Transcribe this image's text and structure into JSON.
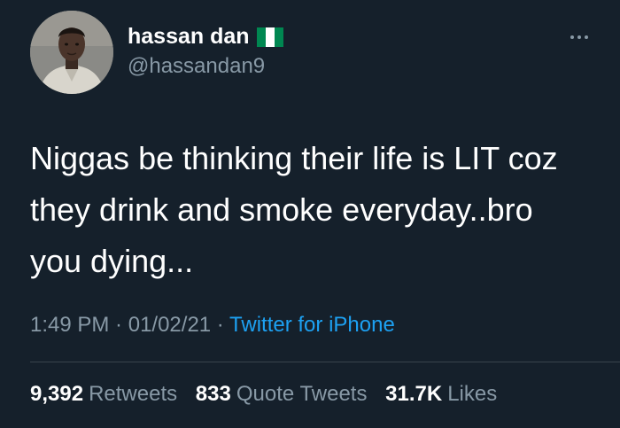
{
  "author": {
    "name": "hassan dan",
    "handle": "@hassandan9",
    "flag_icon": "nigeria-flag-icon",
    "flag_colors": [
      "#008751",
      "#ffffff",
      "#008751"
    ]
  },
  "tweet": {
    "text": "Niggas be thinking their life is LIT coz\nthey drink and smoke everyday..bro\nyou dying..."
  },
  "meta": {
    "time": "1:49 PM",
    "separator": " · ",
    "date": "01/02/21",
    "source": "Twitter for iPhone"
  },
  "stats": {
    "retweets_count": "9,392",
    "retweets_label": "Retweets",
    "quotes_count": "833",
    "quotes_label": "Quote Tweets",
    "likes_count": "31.7K",
    "likes_label": "Likes"
  },
  "colors": {
    "background": "#15202b",
    "text_primary": "#ffffff",
    "text_secondary": "#8899a6",
    "link": "#1da1f2",
    "divider": "#38444d"
  },
  "icons": {
    "more": "more-options-icon"
  }
}
